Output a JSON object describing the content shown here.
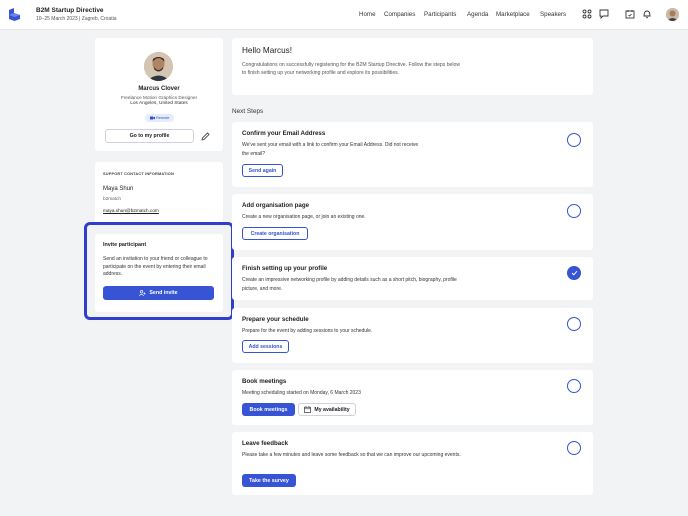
{
  "header": {
    "event_title": "B2M Startup Directive",
    "event_subtitle": "10–25 March 2023 | Zagreb, Croatia",
    "nav": [
      "Home",
      "Companies",
      "Participants",
      "Agenda",
      "Marketplace",
      "Speakers"
    ]
  },
  "profile": {
    "name": "Marcus Clover",
    "role": "Freelance Motion Graphics Designer",
    "location": "Los Angeles, United States",
    "badge": "Remote",
    "profile_button": "Go to my profile"
  },
  "support": {
    "heading": "SUPPORT CONTACT INFORMATION",
    "name": "Maya Shun",
    "org": "b2match",
    "email": "maya.shun@b2match.com"
  },
  "invite": {
    "title": "Invite participant",
    "text": "Send an invitation to your friend or colleague to participate on the event by entering their email address.",
    "button": "Send invite"
  },
  "hello": {
    "title": "Hello Marcus!",
    "text": "Congratulations on successfully registering for the B2M Startup Directive. Follow the steps below to finish setting up your networking profile and explore its possibilities."
  },
  "next_steps_label": "Next Steps",
  "steps": [
    {
      "title": "Confirm your Email Address",
      "desc": "We've sent your email with a link to confirm your Email Address. Did not receive the email?",
      "button": "Send again",
      "done": false
    },
    {
      "title": "Add organisation page",
      "desc": "Create a new organisation page, or join an existing one.",
      "button": "Create organisation",
      "done": false
    },
    {
      "title": "Finish setting up your profile",
      "desc": "Create an impressive networking profile by adding details such as a short pitch, biography, profile picture, and more.",
      "button": "",
      "done": true
    },
    {
      "title": "Prepare your schedule",
      "desc": "Prepare for the event by adding sessions to your schedule.",
      "button": "Add sessions",
      "done": false
    },
    {
      "title": "Book meetings",
      "desc": "Meeting scheduling started on Monday, 6 March 2023",
      "button": "Book meetings",
      "secondary_button": "My availability",
      "done": false
    },
    {
      "title": "Leave feedback",
      "desc": "Please take a few minutes and leave some feedback so that we can improve our upcoming events.",
      "button": "Take the survey",
      "done": false
    }
  ],
  "colors": {
    "accent": "#3654d3",
    "highlight_outline": "#2f3fcb",
    "background": "#f2f3f5"
  }
}
